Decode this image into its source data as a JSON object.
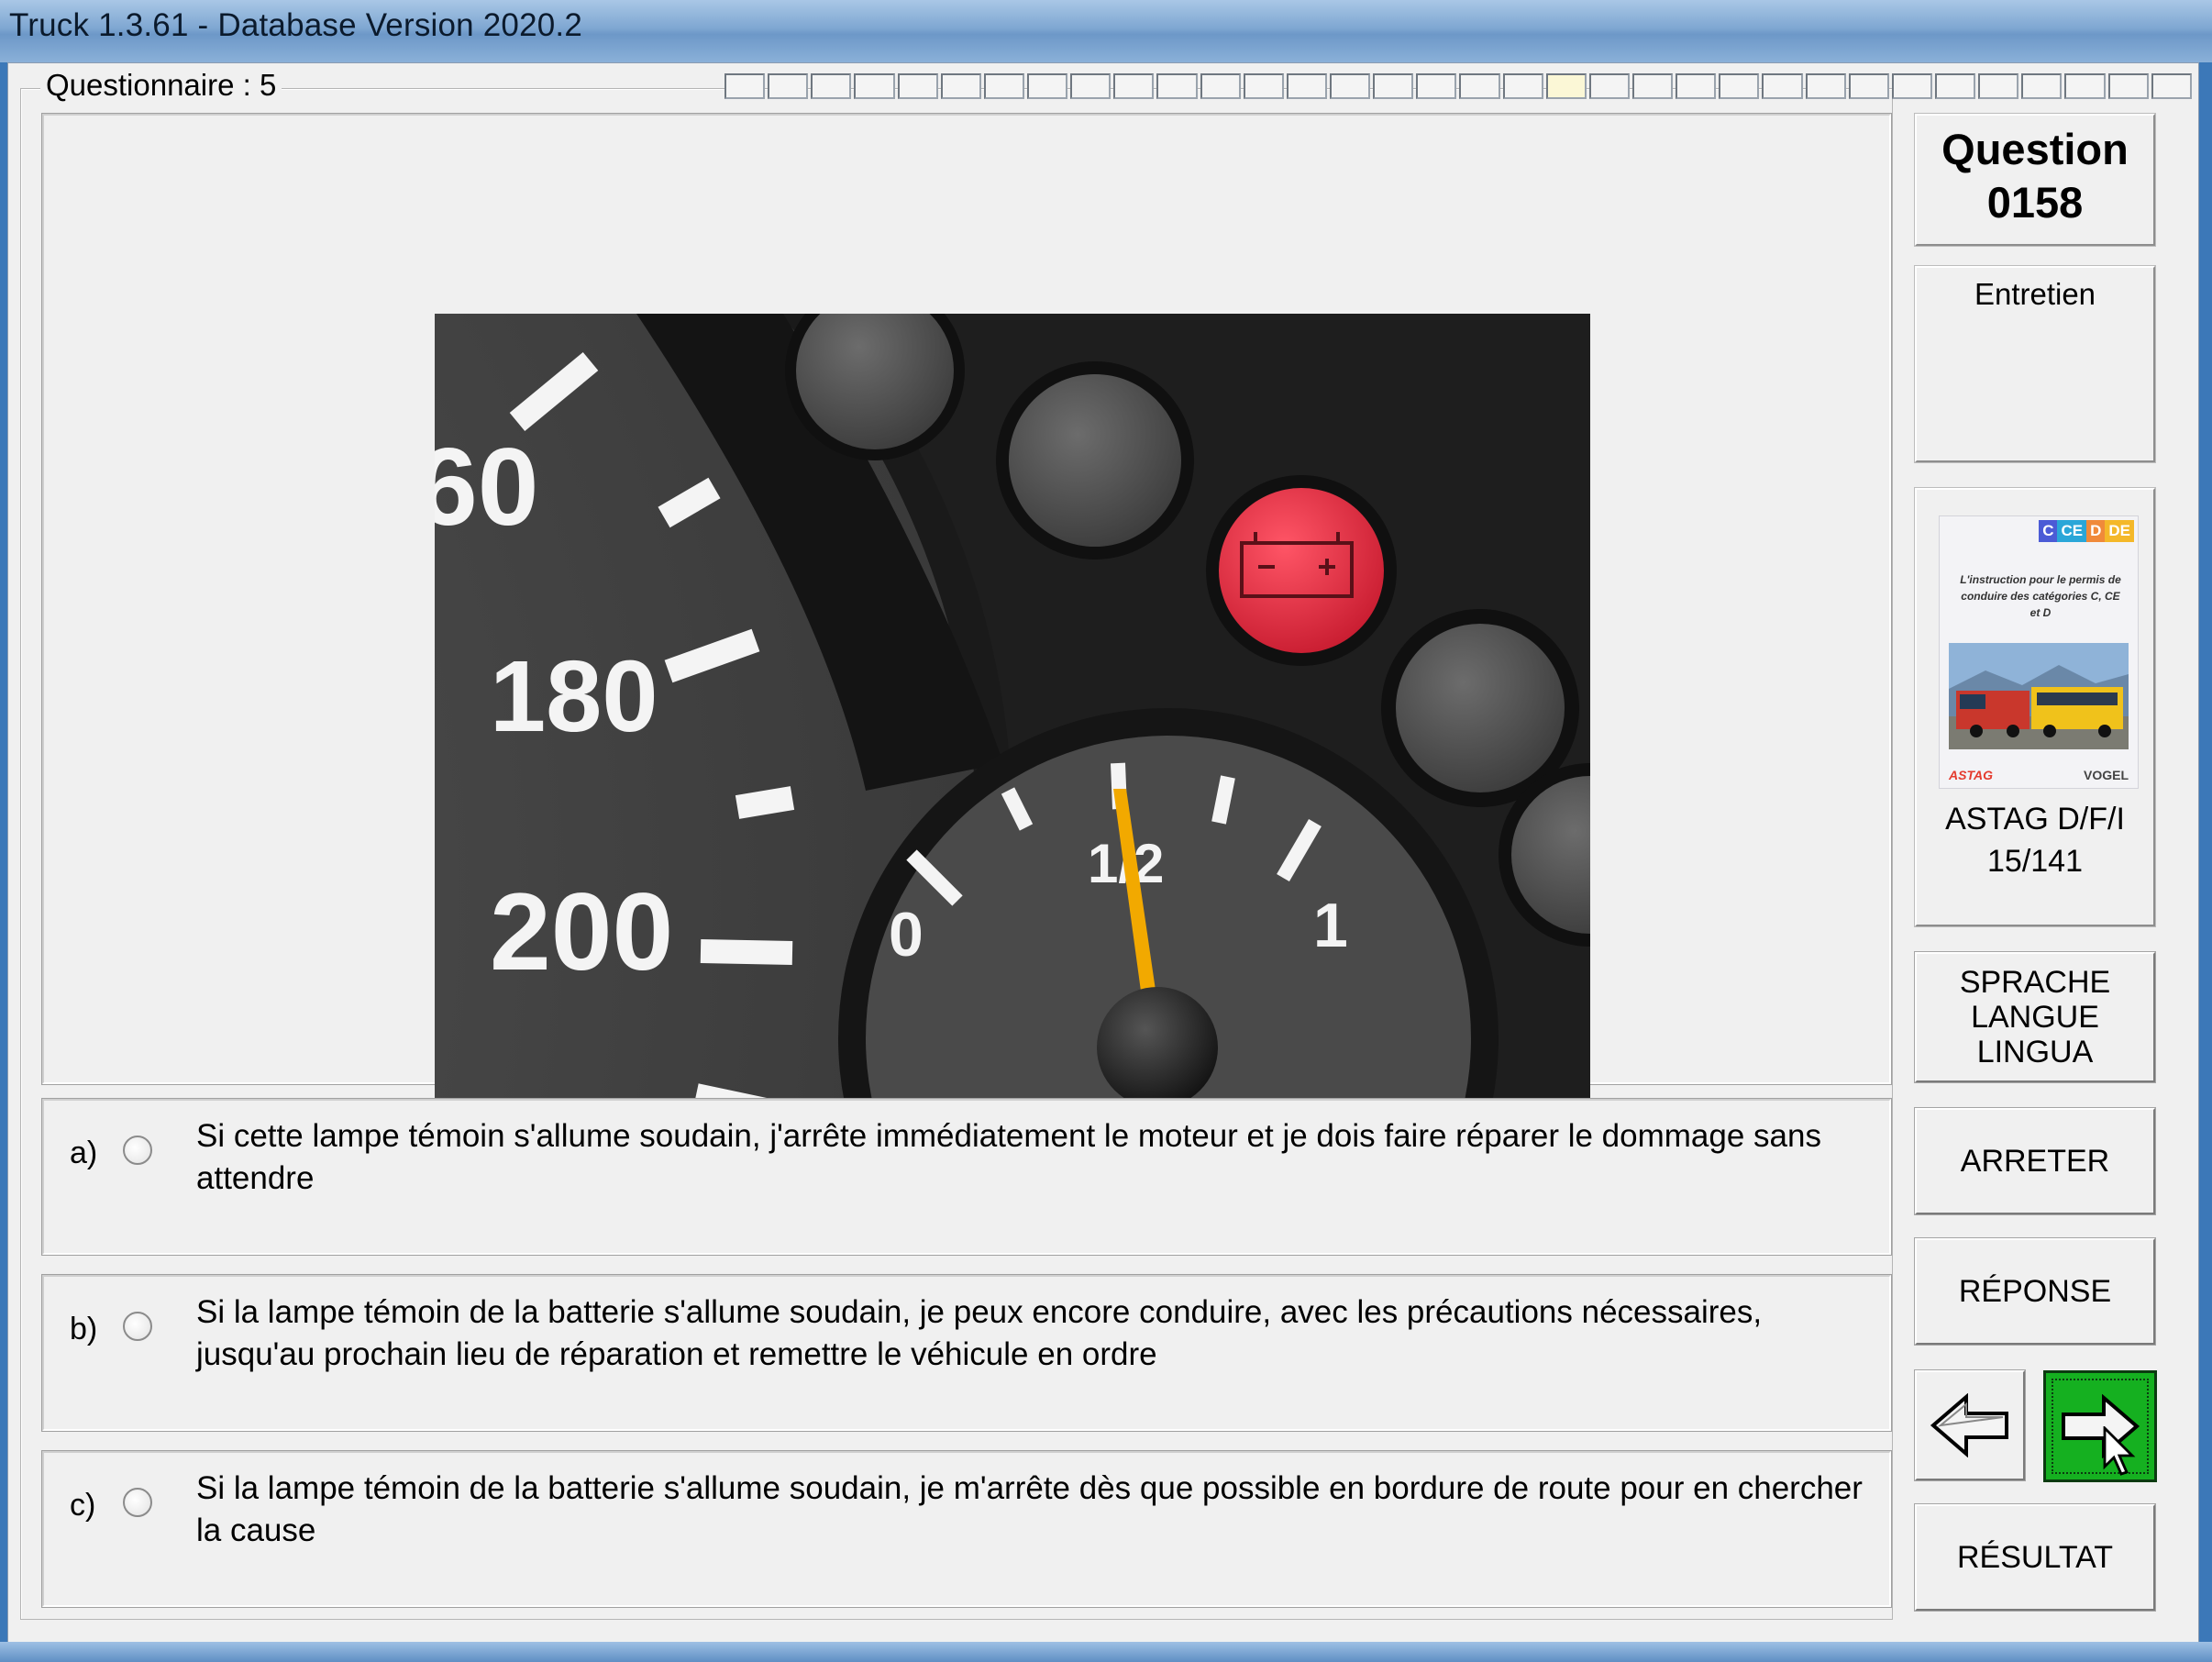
{
  "window": {
    "title": "Truck 1.3.61 - Database Version 2020.2"
  },
  "questionnaire": {
    "label": "Questionnaire : 5",
    "progress_total": 34,
    "progress_current": 19
  },
  "image": {
    "description_icon": "dashboard-battery-warning-photo",
    "speed_labels": [
      "60",
      "180",
      "200"
    ],
    "gauge_labels": [
      "0",
      "1/2",
      "1"
    ]
  },
  "answers": [
    {
      "letter": "a)",
      "text": "Si cette lampe témoin s'allume soudain, j'arrête immédiatement le moteur et je dois faire réparer le dommage sans attendre"
    },
    {
      "letter": "b)",
      "text": "Si la lampe témoin de la batterie s'allume soudain, je peux encore conduire, avec les précautions nécessaires, jusqu'au prochain lieu de réparation et remettre le véhicule en ordre"
    },
    {
      "letter": "c)",
      "text": "Si la lampe témoin de la batterie s'allume soudain, je m'arrête dès que possible en bordure de route pour en chercher la cause"
    }
  ],
  "sidebar": {
    "question_label": "Question",
    "question_number": "0158",
    "category": "Entretien",
    "book": {
      "tags": [
        "C",
        "CE",
        "D",
        "DE"
      ],
      "title": "L'instruction pour le permis de conduire des catégories C, CE et D",
      "publisher_left": "ASTAG",
      "publisher_right": "VOGEL",
      "caption": "ASTAG D/F/I",
      "page": "15/141"
    },
    "language_button": [
      "SPRACHE",
      "LANGUE",
      "LINGUA"
    ],
    "stop_button": "ARRETER",
    "answer_button": "RÉPONSE",
    "prev_icon": "arrow-left-icon",
    "next_icon": "arrow-right-icon",
    "result_button": "RÉSULTAT"
  },
  "colors": {
    "next_button": "#15b020",
    "warning_lamp": "#e0283a",
    "needle": "#f2a900"
  }
}
